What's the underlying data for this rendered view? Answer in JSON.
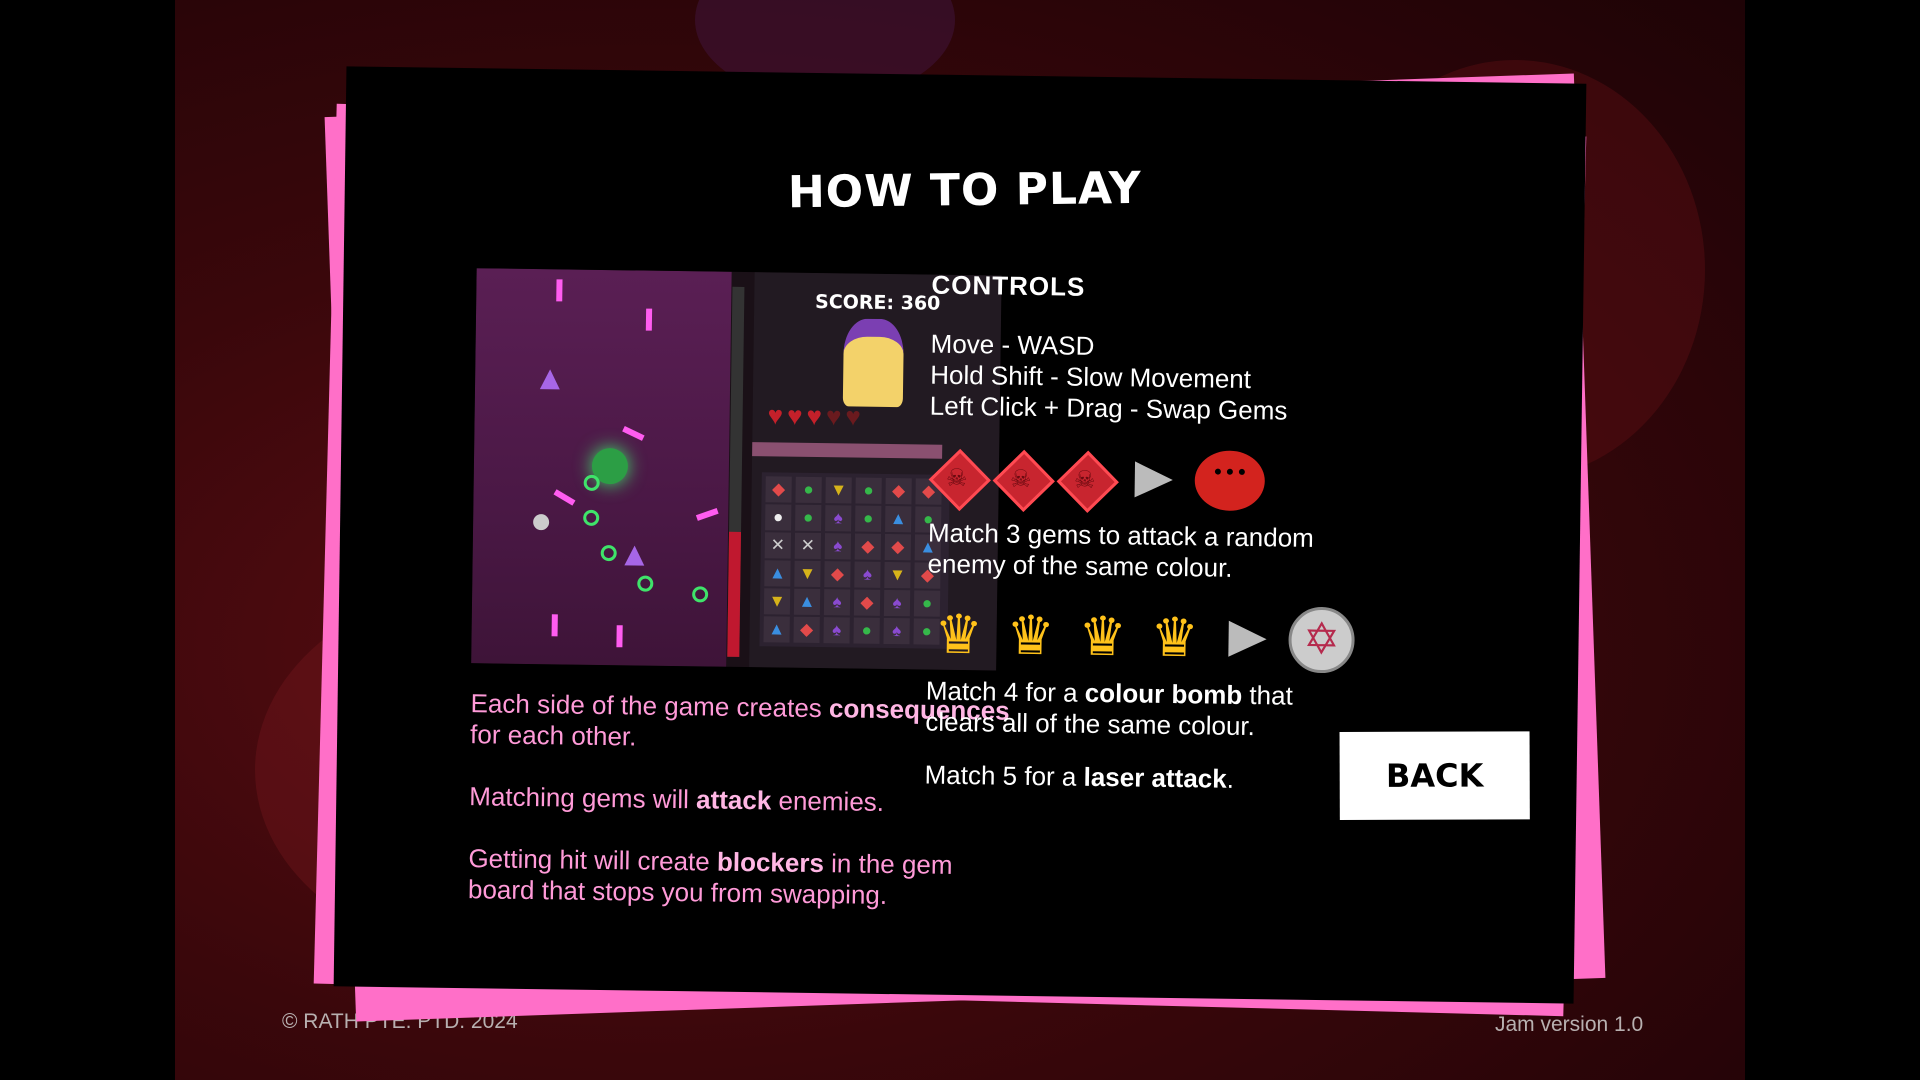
{
  "title": "HOW TO PLAY",
  "preview": {
    "score_label": "SCORE: 360"
  },
  "description": {
    "p1_pre": "Each side of the game creates ",
    "p1_bold": "consequences",
    "p1_post": " for each other.",
    "p2_pre": "Matching gems will ",
    "p2_bold": "attack",
    "p2_post": " enemies.",
    "p3_pre": "Getting hit will create ",
    "p3_bold": "blockers",
    "p3_post": " in the gem board that stops you from swapping."
  },
  "controls": {
    "heading": "CONTROLS",
    "lines": [
      "Move - WASD",
      "Hold Shift - Slow Movement",
      "Left Click + Drag - Swap Gems"
    ],
    "match3": "Match 3 gems to attack a random enemy of the same colour.",
    "match4_pre": "Match 4 for a ",
    "match4_bold": "colour bomb",
    "match4_post": " that clears all of the same colour.",
    "match5_pre": "Match 5 for a ",
    "match5_bold": "laser attack",
    "match5_post": "."
  },
  "back_label": "BACK",
  "footer": {
    "copyright": "© RATH PTE. PTD. 2024",
    "version": "Jam version 1.0"
  },
  "colors": {
    "accent_pink": "#ff6fc8",
    "text_pink": "#ff9ad8",
    "gem_red": "#c8252f",
    "gem_yellow": "#ffc21a",
    "enemy_red": "#d3231e"
  }
}
